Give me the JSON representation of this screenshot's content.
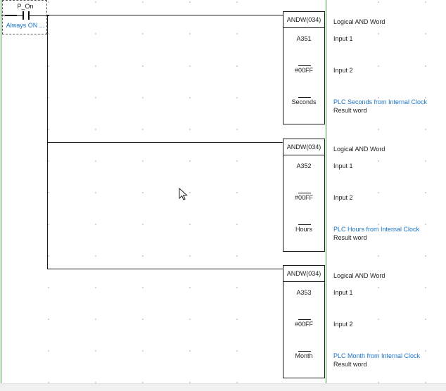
{
  "contact": {
    "name": "P_On",
    "comment": "Always ON ..."
  },
  "blocks": [
    {
      "instruction": "ANDW(034)",
      "description": "Logical AND Word",
      "operands": [
        {
          "value": "A351",
          "description": "Input 1",
          "overbar": false
        },
        {
          "value": "#00FF",
          "description": "Input 2",
          "overbar": true
        },
        {
          "value": "Seconds",
          "description": "PLC Seconds from Internal Clock",
          "sub": "Result word",
          "overbar": true
        }
      ]
    },
    {
      "instruction": "ANDW(034)",
      "description": "Logical AND Word",
      "operands": [
        {
          "value": "A352",
          "description": "Input 1",
          "overbar": false
        },
        {
          "value": "#00FF",
          "description": "Input 2",
          "overbar": true
        },
        {
          "value": "Hours",
          "description": "PLC Hours from Internal Clock",
          "sub": "Result word",
          "overbar": true
        }
      ]
    },
    {
      "instruction": "ANDW(034)",
      "description": "Logical AND Word",
      "operands": [
        {
          "value": "A353",
          "description": "Input 1",
          "overbar": false
        },
        {
          "value": "#00FF",
          "description": "Input 2",
          "overbar": true
        },
        {
          "value": "Month",
          "description": "PLC Month from Internal Clock",
          "sub": "Result word",
          "overbar": true
        }
      ]
    }
  ],
  "colors": {
    "rail": "#3a9a3a",
    "comment": "#1a73c7",
    "wire": "#1a1a1a",
    "grid_dot": "#c9c9c9"
  },
  "icons": {
    "contact": "normally-open-contact-icon",
    "cursor": "mouse-pointer-icon"
  }
}
